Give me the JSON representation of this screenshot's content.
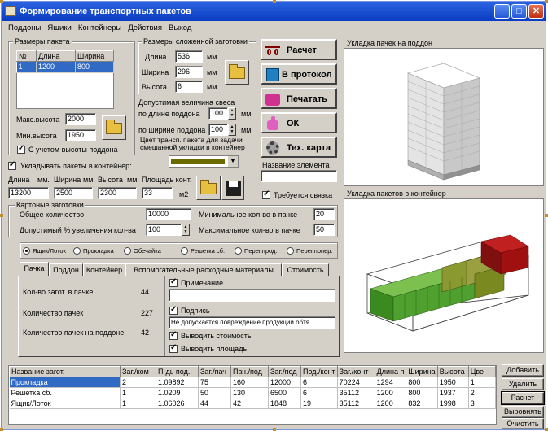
{
  "window": {
    "title": "Формирование транспортных пакетов",
    "min": "_",
    "max": "□",
    "close": "✕"
  },
  "menu": [
    "Поддоны",
    "Ящики",
    "Контейнеры",
    "Действия",
    "Выход"
  ],
  "package": {
    "group_label": "Размеры пакета",
    "columns": [
      "№",
      "Длина",
      "Ширина"
    ],
    "rows": [
      [
        "1",
        "1200",
        "800"
      ]
    ],
    "max_height_label": "Макс.высота",
    "max_height": "2000",
    "min_height_label": "Мин.высота",
    "min_height": "1950",
    "pallet_height_label": "С учетом высоты поддона"
  },
  "blank": {
    "group_label": "Размеры сложенной заготовки",
    "length_label": "Длина",
    "length": "536",
    "width_label": "Ширина",
    "width": "296",
    "height_label": "Высота",
    "height": "6",
    "unit": "мм"
  },
  "overhang": {
    "label": "Допустимая величина свеса",
    "by_length_label": "по длине поддона",
    "by_length": "100",
    "by_width_label": "по ширине поддона",
    "by_width": "100",
    "unit": "мм"
  },
  "color_label": "Цвет трансп. пакета для задачи смешанной укладки в контейнер",
  "container": {
    "check_label": "Укладывать пакеты в контейнер:",
    "length_label": "Длина",
    "length_unit": "мм.",
    "width_label": "Ширина",
    "width_unit": "мм.",
    "height_label": "Высота",
    "height_unit": "мм.",
    "area_label": "Площадь конт.",
    "length": "13200",
    "width": "2500",
    "height": "2300",
    "area": "33",
    "area_unit": "м2"
  },
  "buttons": {
    "calc": "Расчет",
    "protocol": "В протокол",
    "print": "Печатать",
    "ok": "ОК",
    "tech": "Тех. карта"
  },
  "element_name_label": "Название элемента",
  "element_name": "",
  "binding_label": "Требуется связка",
  "cardboard": {
    "group_label": "Картоные заготовки",
    "total_label": "Общее количество",
    "total": "10000",
    "pct_label": "Допустимый % увеличения кол-ва",
    "pct": "100",
    "min_label": "Минимальное кол-во в пачке",
    "min": "20",
    "max_label": "Максимальное кол-во в пачке",
    "max": "50"
  },
  "radios": [
    "Ящик/Лоток",
    "Прокладка",
    "Обечайка",
    "Решетка сб.",
    "Перег.прод.",
    "Перег.попер."
  ],
  "tabs": [
    "Пачка",
    "Поддон",
    "Контейнер",
    "Вспомогательные расходные материалы",
    "Стоимость"
  ],
  "pack_info": {
    "per_pack_label": "Кол-во загот. в пачке",
    "per_pack": "44",
    "packs_label": "Количество пачек",
    "packs": "227",
    "per_pallet_label": "Количество пачек на поддоне",
    "per_pallet": "42"
  },
  "notes": {
    "note_label": "Примечание",
    "note": "",
    "sign_label": "Подпись",
    "sign": "Не допускается повреждение продукции обтя",
    "cost_label": "Выводить стоимость",
    "area_label": "Выводить площадь"
  },
  "views": {
    "pallet_title": "Укладка пачек на поддон",
    "container_title": "Укладка пакетов в контейнер"
  },
  "table": {
    "columns": [
      "Название загот.",
      "Заг./ком",
      "П-дь под.",
      "Заг./пач",
      "Пач./под",
      "Заг./под",
      "Под./конт",
      "Заг./конт",
      "Длина п",
      "Ширина",
      "Высота",
      "Цве"
    ],
    "rows": [
      [
        "Прокладка",
        "2",
        "1.09892",
        "75",
        "160",
        "12000",
        "6",
        "70224",
        "1294",
        "800",
        "1950",
        "1"
      ],
      [
        "Решетка сб.",
        "1",
        "1.0209",
        "50",
        "130",
        "6500",
        "6",
        "35112",
        "1200",
        "800",
        "1937",
        "2"
      ],
      [
        "Ящик/Лоток",
        "1",
        "1.06026",
        "44",
        "42",
        "1848",
        "19",
        "35112",
        "1200",
        "832",
        "1998",
        "3"
      ]
    ]
  },
  "side_buttons": [
    "Добавить",
    "Удалить",
    "Расчет",
    "Выровнять",
    "Очистить"
  ]
}
